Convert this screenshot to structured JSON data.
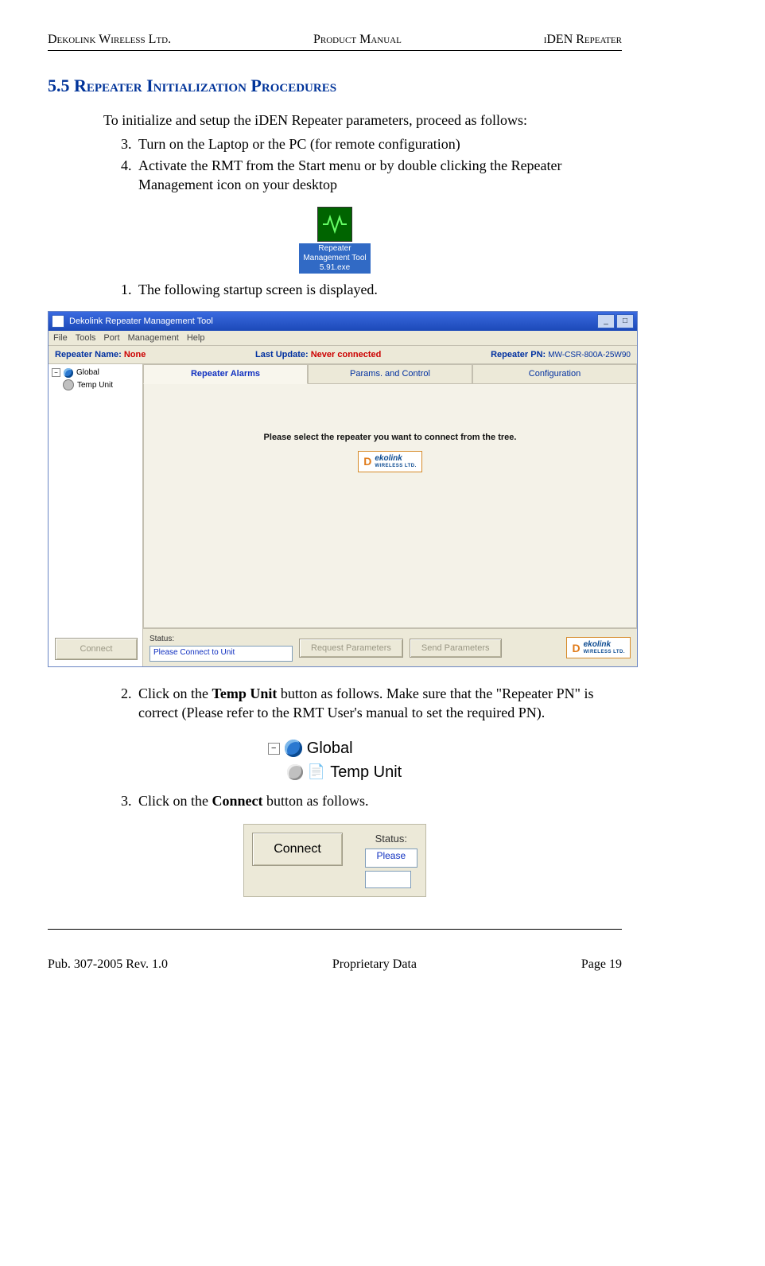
{
  "header": {
    "left": "Dekolink Wireless Ltd.",
    "center": "Product Manual",
    "right": "iDEN Repeater"
  },
  "footer": {
    "left": "Pub. 307-2005 Rev. 1.0",
    "center": "Proprietary Data",
    "right": "Page 19"
  },
  "section": {
    "number": "5.5",
    "title": "Repeater Initialization Procedures"
  },
  "intro": "To initialize and setup the iDEN Repeater parameters, proceed as follows:",
  "steps_a": {
    "n3": "Turn on the Laptop or the PC (for remote configuration)",
    "n4": "Activate the RMT from the Start menu or by double clicking the Repeater Management icon on your desktop"
  },
  "desktop_icon": {
    "label": "Repeater Management Tool 5.91.exe"
  },
  "step_b1": "The following startup screen is displayed.",
  "app": {
    "title": "Dekolink Repeater Management Tool",
    "menus": [
      "File",
      "Tools",
      "Port",
      "Management",
      "Help"
    ],
    "info": {
      "name_label": "Repeater Name:",
      "name_value": "None",
      "update_label": "Last Update:",
      "update_value": "Never connected",
      "pn_label": "Repeater PN:",
      "pn_value": "MW-CSR-800A-25W90"
    },
    "tabs": [
      "Repeater Alarms",
      "Params. and Control",
      "Configuration"
    ],
    "tree": {
      "root": "Global",
      "child": "Temp Unit"
    },
    "center_message": "Please select the repeater you want to connect from the tree.",
    "logo_text": "ekolink",
    "logo_sub": "WIRELESS LTD.",
    "buttons": {
      "connect": "Connect",
      "request": "Request Parameters",
      "send": "Send Parameters"
    },
    "status_label": "Status:",
    "status_value": "Please Connect to Unit"
  },
  "step_c2_pre": "Click on the ",
  "step_c2_bold": "Temp Unit",
  "step_c2_post": " button as follows.  Make sure that the \"Repeater PN\" is correct (Please refer to the RMT User's manual to set the required PN).",
  "tree_fig": {
    "root": "Global",
    "child": "Temp Unit"
  },
  "step_d3_pre": "Click on the ",
  "step_d3_bold": "Connect",
  "step_d3_post": " button as follows.",
  "connect_fig": {
    "button": "Connect",
    "status_label": "Status:",
    "status_value": "Please"
  },
  "sys": {
    "min": "_",
    "max": "□"
  }
}
